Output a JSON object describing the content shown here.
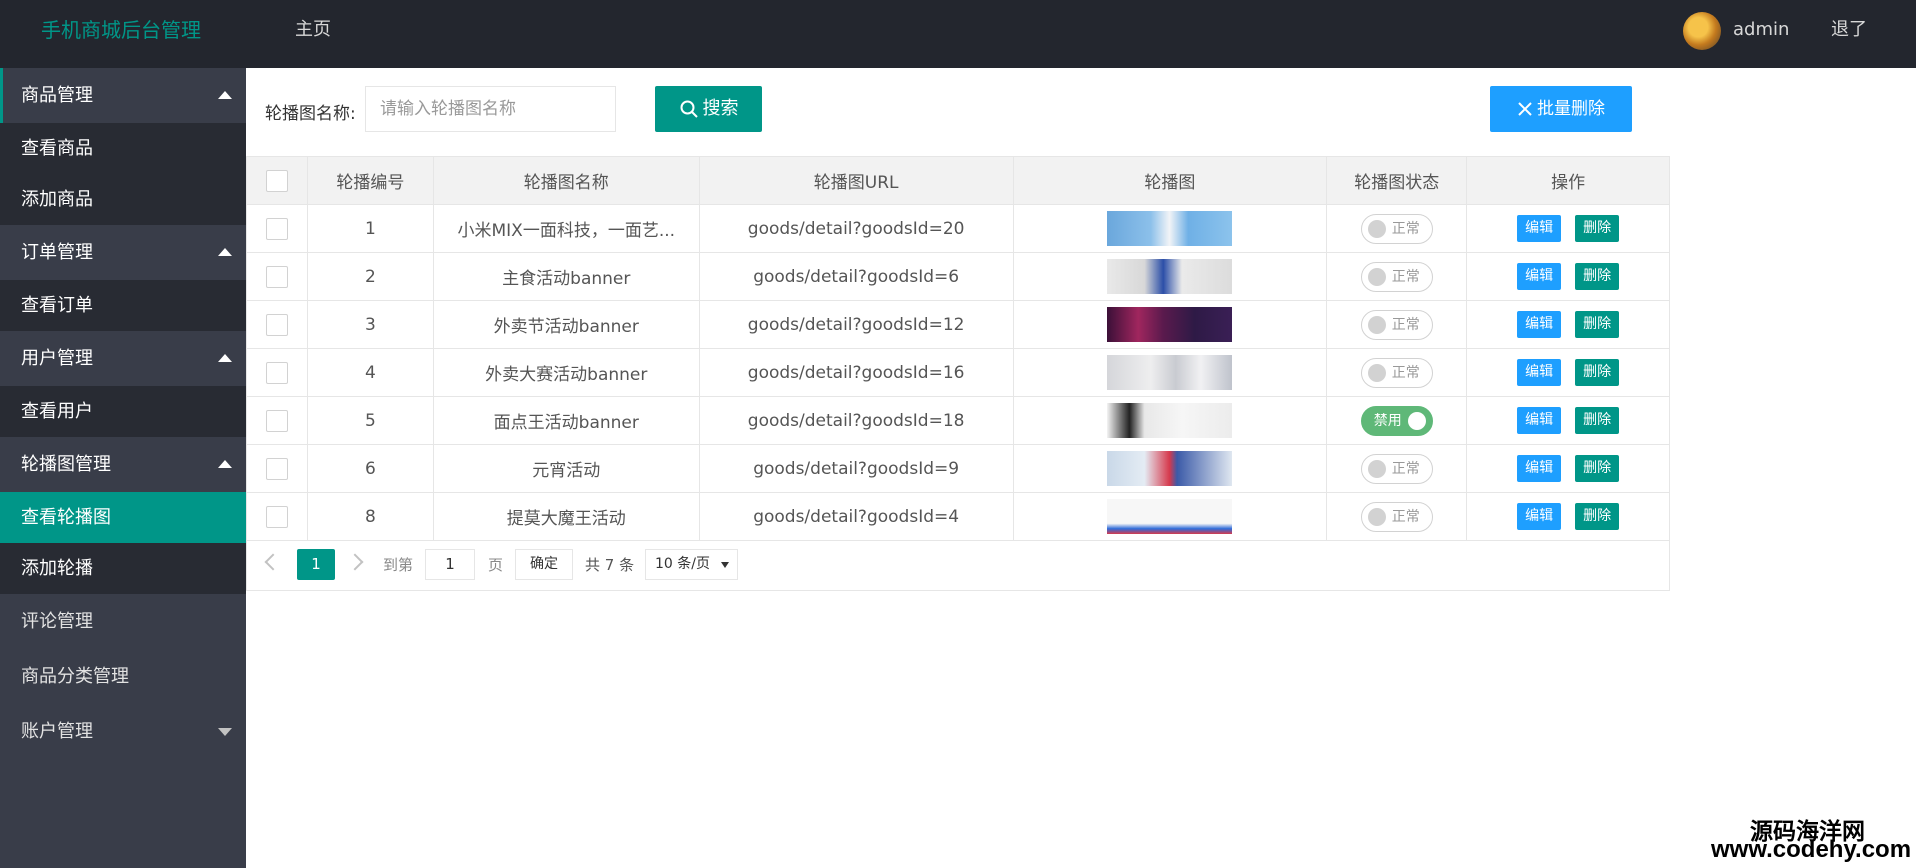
{
  "header": {
    "logo": "手机商城后台管理",
    "nav_home": "主页",
    "username": "admin",
    "logout": "退了"
  },
  "sidebar": {
    "groups": [
      {
        "label": "商品管理",
        "items": [
          "查看商品",
          "添加商品"
        ]
      },
      {
        "label": "订单管理",
        "items": [
          "查看订单"
        ]
      },
      {
        "label": "用户管理",
        "items": [
          "查看用户"
        ]
      },
      {
        "label": "轮播图管理",
        "items": [
          "查看轮播图",
          "添加轮播"
        ]
      }
    ],
    "plain": [
      "评论管理",
      "商品分类管理",
      "账户管理"
    ]
  },
  "toolbar": {
    "search_label": "轮播图名称:",
    "search_placeholder": "请输入轮播图名称",
    "search_button": "搜索",
    "batch_delete_button": "批量删除"
  },
  "table": {
    "headers": [
      "轮播编号",
      "轮播图名称",
      "轮播图URL",
      "轮播图",
      "轮播图状态",
      "操作"
    ],
    "rows": [
      {
        "id": "1",
        "name": "小米MIX一面科技，一面艺...",
        "url": "goods/detail?goodsId=20",
        "status": "正常",
        "enabled": false
      },
      {
        "id": "2",
        "name": "主食活动banner",
        "url": "goods/detail?goodsId=6",
        "status": "正常",
        "enabled": false
      },
      {
        "id": "3",
        "name": "外卖节活动banner",
        "url": "goods/detail?goodsId=12",
        "status": "正常",
        "enabled": false
      },
      {
        "id": "4",
        "name": "外卖大赛活动banner",
        "url": "goods/detail?goodsId=16",
        "status": "正常",
        "enabled": false
      },
      {
        "id": "5",
        "name": "面点王活动banner",
        "url": "goods/detail?goodsId=18",
        "status": "禁用",
        "enabled": true
      },
      {
        "id": "6",
        "name": "元宵活动",
        "url": "goods/detail?goodsId=9",
        "status": "正常",
        "enabled": false
      },
      {
        "id": "8",
        "name": "提莫大魔王活动",
        "url": "goods/detail?goodsId=4",
        "status": "正常",
        "enabled": false
      }
    ],
    "edit_label": "编辑",
    "delete_label": "删除"
  },
  "pager": {
    "current": "1",
    "goto_prefix": "到第",
    "goto_value": "1",
    "goto_suffix": "页",
    "confirm": "确定",
    "total": "共 7 条",
    "page_size": "10 条/页"
  },
  "watermark": {
    "line1": "源码海洋网",
    "line2": "www.codehy.com"
  },
  "colors": {
    "primary": "#009688",
    "blue": "#1e9fff",
    "header_bg": "#23262e",
    "sidebar_bg": "#393d49",
    "switch_on": "#5fb878"
  }
}
